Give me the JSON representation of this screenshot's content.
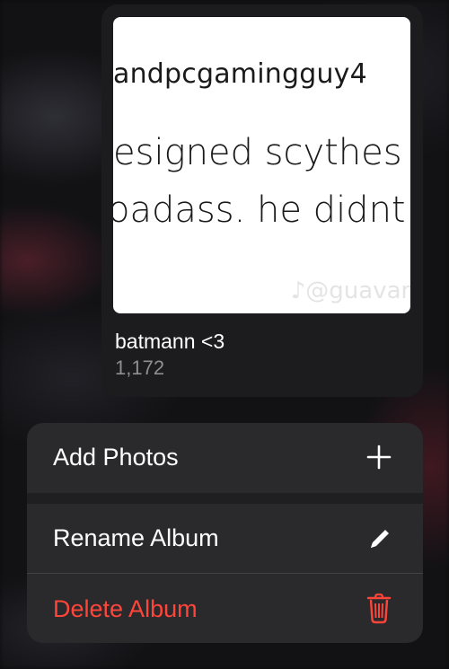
{
  "album": {
    "title": "batmann <3",
    "count": "1,172",
    "thumbnail": {
      "line1": "andpcgamingguy4",
      "line2": "esigned scythes d",
      "line3": "oadass. he didnt ca",
      "watermark": "♪@guavan"
    }
  },
  "menu": {
    "add_photos_label": "Add Photos",
    "add_photos_icon": "plus-icon",
    "rename_album_label": "Rename Album",
    "rename_album_icon": "pencil-icon",
    "delete_album_label": "Delete Album",
    "delete_album_icon": "trash-icon"
  },
  "colors": {
    "destructive": "#ff453a",
    "menu_background": "#2a2a2c",
    "card_background": "#1c1c1e",
    "secondary_text": "#8e8e93"
  }
}
